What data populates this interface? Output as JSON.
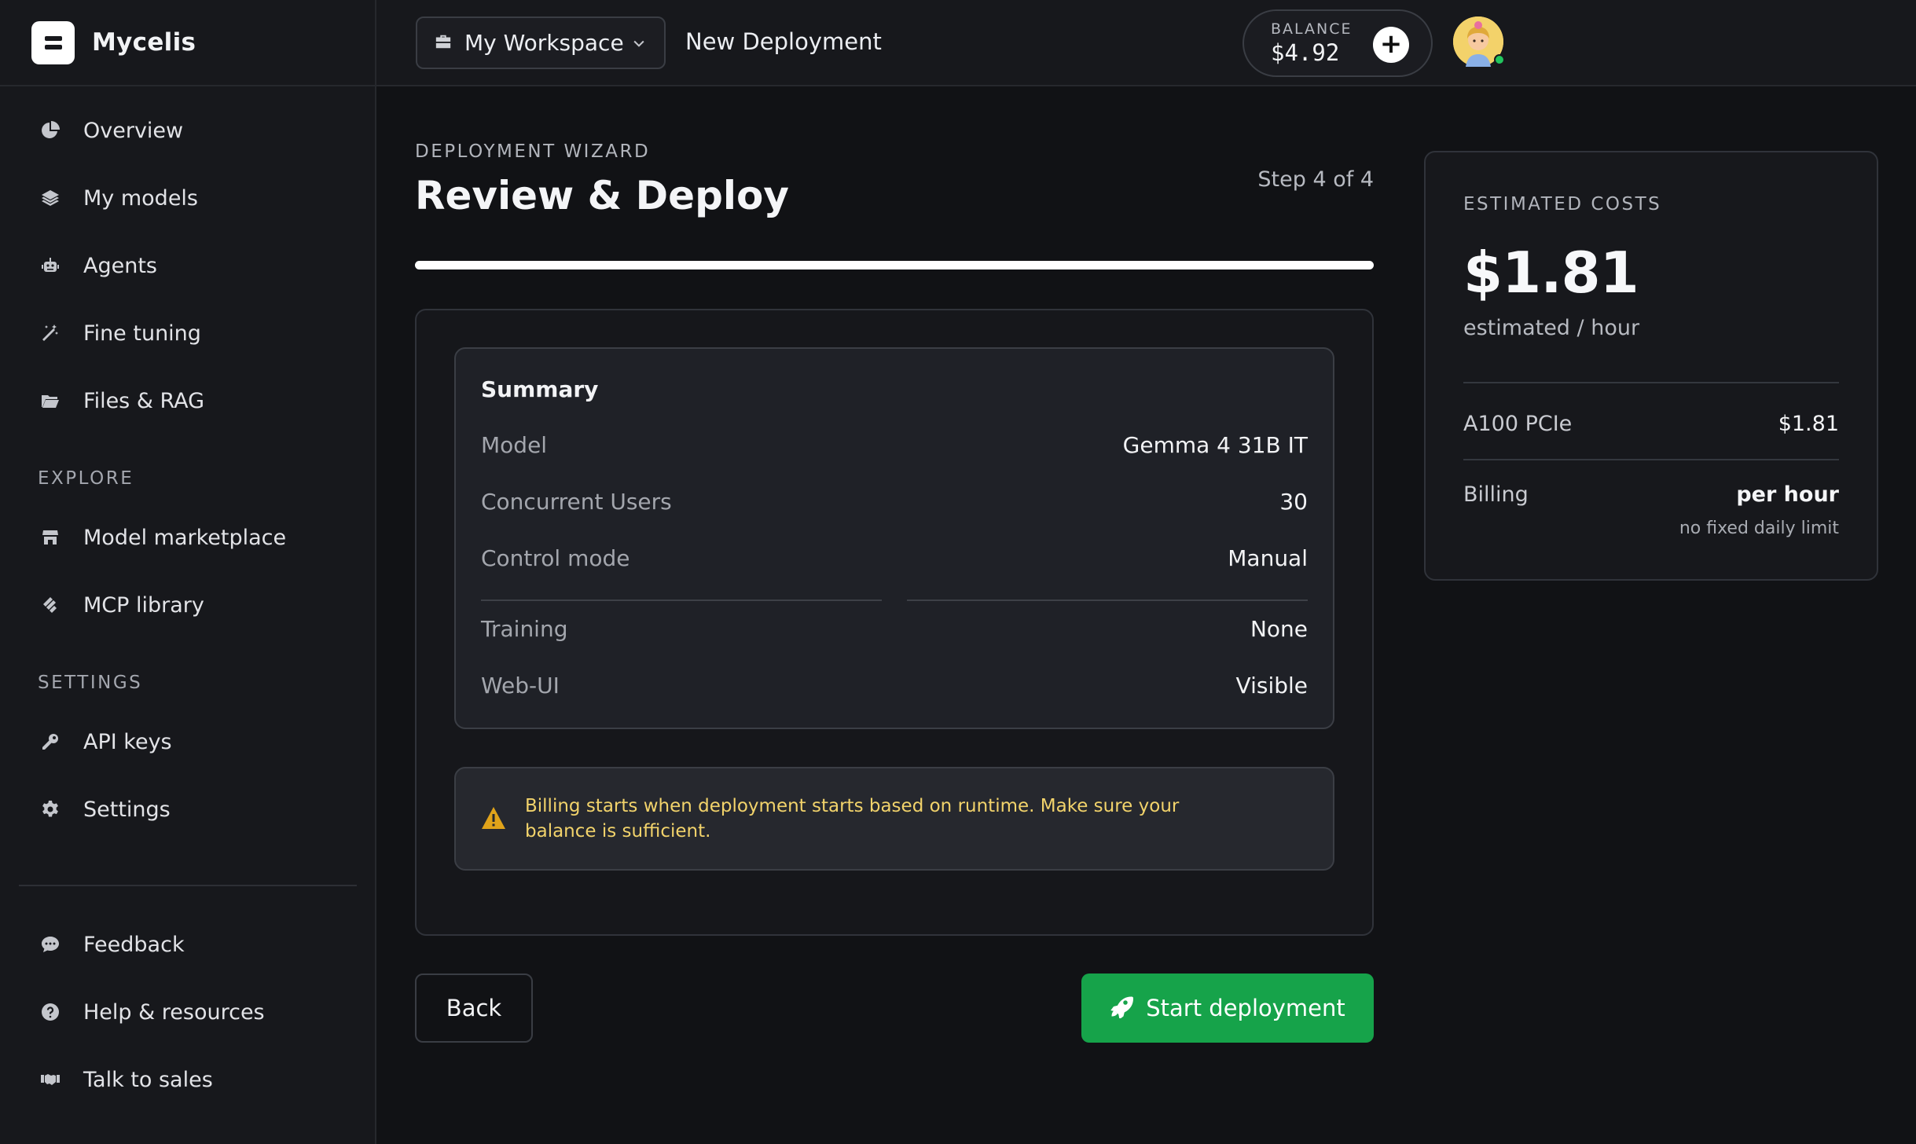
{
  "app": {
    "name": "Mycelis"
  },
  "sidebar": {
    "main_items": [
      {
        "label": "Overview",
        "icon": "pie-chart-icon"
      },
      {
        "label": "My models",
        "icon": "layers-icon"
      },
      {
        "label": "Agents",
        "icon": "robot-icon"
      },
      {
        "label": "Fine tuning",
        "icon": "magic-wand-icon"
      },
      {
        "label": "Files & RAG",
        "icon": "folder-open-icon"
      }
    ],
    "explore_label": "EXPLORE",
    "explore_items": [
      {
        "label": "Model marketplace",
        "icon": "store-icon"
      },
      {
        "label": "MCP library",
        "icon": "mcp-icon"
      }
    ],
    "settings_label": "SETTINGS",
    "settings_items": [
      {
        "label": "API keys",
        "icon": "key-icon"
      },
      {
        "label": "Settings",
        "icon": "gear-icon"
      }
    ],
    "footer_items": [
      {
        "label": "Feedback",
        "icon": "chat-bubble-icon"
      },
      {
        "label": "Help & resources",
        "icon": "help-circle-icon"
      },
      {
        "label": "Talk to sales",
        "icon": "handshake-icon"
      }
    ]
  },
  "topbar": {
    "workspace": "My Workspace",
    "breadcrumb": "New Deployment",
    "balance_label": "BALANCE",
    "balance_value": "$4.92",
    "add_funds_symbol": "+"
  },
  "wizard": {
    "eyebrow": "DEPLOYMENT WIZARD",
    "title": "Review & Deploy",
    "step_text": "Step 4 of 4",
    "progress": 1.0
  },
  "summary": {
    "title": "Summary",
    "rows": [
      {
        "label": "Model",
        "value": "Gemma 4 31B IT"
      },
      {
        "label": "Concurrent Users",
        "value": "30"
      },
      {
        "label": "Control mode",
        "value": "Manual"
      },
      {
        "label": "Training",
        "value": "None"
      },
      {
        "label": "Web-UI",
        "value": "Visible"
      }
    ]
  },
  "warning": {
    "text": "Billing starts when deployment starts based on runtime. Make sure your balance is sufficient.",
    "color": "#f2d36b"
  },
  "actions": {
    "back": "Back",
    "start": "Start deployment",
    "start_color": "#16a34a"
  },
  "costs": {
    "eyebrow": "ESTIMATED COSTS",
    "total": "$1.81",
    "total_sub": "estimated / hour",
    "gpu_label": "A100 PCIe",
    "gpu_value": "$1.81",
    "billing_label": "Billing",
    "billing_value": "per hour",
    "billing_note": "no fixed daily limit"
  }
}
